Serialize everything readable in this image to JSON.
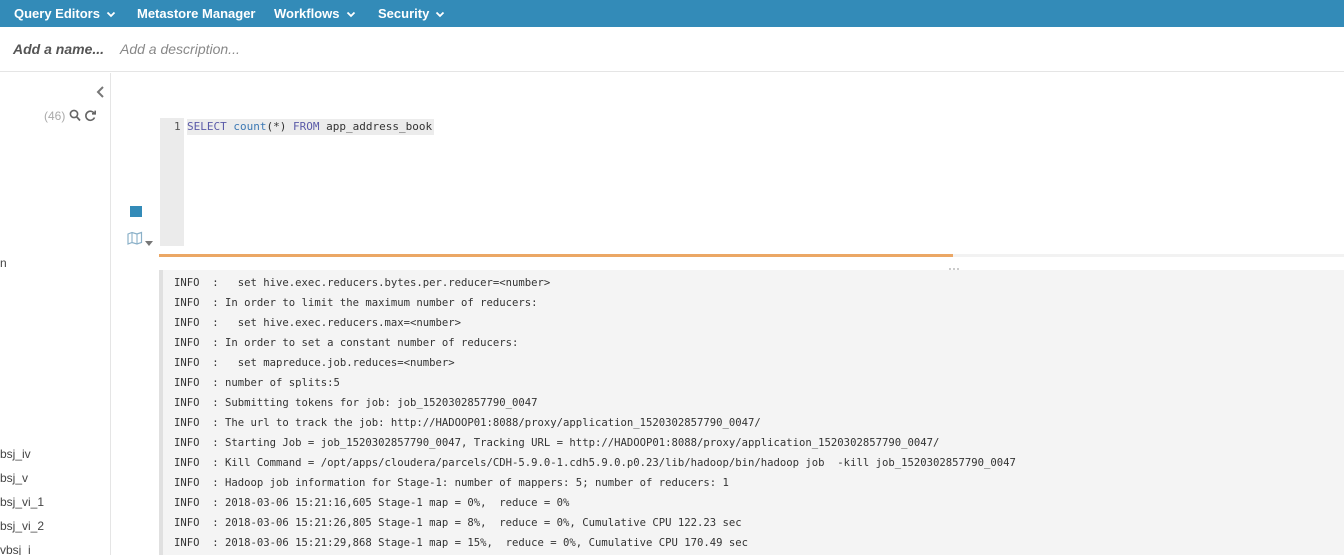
{
  "nav": {
    "items": [
      {
        "label": "Query Editors",
        "dropdown": true
      },
      {
        "label": "Metastore Manager",
        "dropdown": false
      },
      {
        "label": "Workflows",
        "dropdown": true
      },
      {
        "label": "Security",
        "dropdown": true
      }
    ]
  },
  "titlebar": {
    "name_placeholder": "Add a name...",
    "description_placeholder": "Add a description..."
  },
  "left_panel": {
    "count": "(46)",
    "tables": [
      "n",
      "bsj_iv",
      "bsj_v",
      "bsj_vi_1",
      "bsj_vi_2",
      "vbsj_i"
    ]
  },
  "editor": {
    "line_number": "1",
    "tokens": [
      "SELECT",
      "count",
      "(*)",
      "FROM",
      "app_address_book"
    ]
  },
  "progress": {
    "percent": 67,
    "color": "#eba765"
  },
  "colors": {
    "accent": "#338bb8"
  },
  "log": {
    "lines": [
      "INFO  :   set hive.exec.reducers.bytes.per.reducer=<number>",
      "INFO  : In order to limit the maximum number of reducers:",
      "INFO  :   set hive.exec.reducers.max=<number>",
      "INFO  : In order to set a constant number of reducers:",
      "INFO  :   set mapreduce.job.reduces=<number>",
      "INFO  : number of splits:5",
      "INFO  : Submitting tokens for job: job_1520302857790_0047",
      "INFO  : The url to track the job: http://HADOOP01:8088/proxy/application_1520302857790_0047/",
      "INFO  : Starting Job = job_1520302857790_0047, Tracking URL = http://HADOOP01:8088/proxy/application_1520302857790_0047/",
      "INFO  : Kill Command = /opt/apps/cloudera/parcels/CDH-5.9.0-1.cdh5.9.0.p0.23/lib/hadoop/bin/hadoop job  -kill job_1520302857790_0047",
      "INFO  : Hadoop job information for Stage-1: number of mappers: 5; number of reducers: 1",
      "INFO  : 2018-03-06 15:21:16,605 Stage-1 map = 0%,  reduce = 0%",
      "INFO  : 2018-03-06 15:21:26,805 Stage-1 map = 8%,  reduce = 0%, Cumulative CPU 122.23 sec",
      "INFO  : 2018-03-06 15:21:29,868 Stage-1 map = 15%,  reduce = 0%, Cumulative CPU 170.49 sec"
    ]
  }
}
